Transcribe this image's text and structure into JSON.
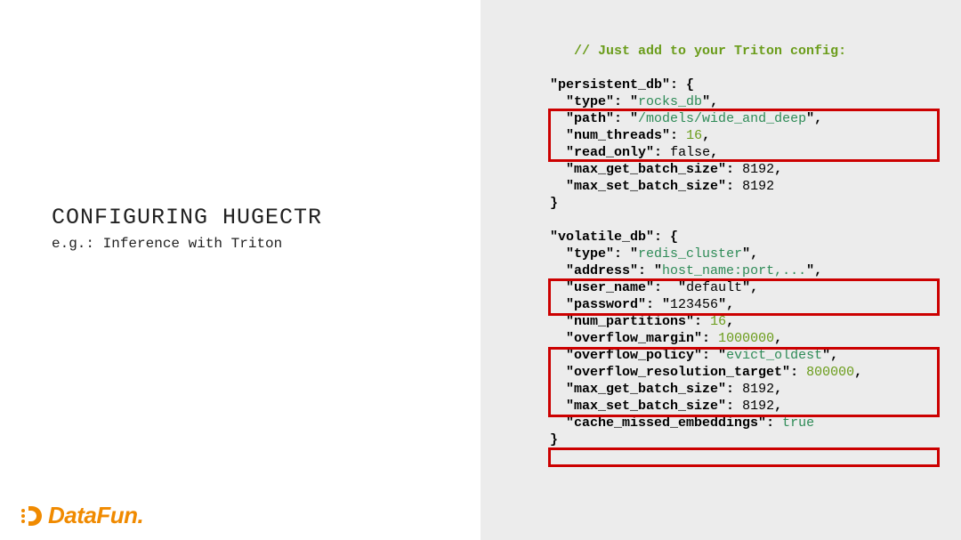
{
  "left": {
    "title": "CONFIGURING HUGECTR",
    "subtitle": "e.g.: Inference with Triton"
  },
  "logo": {
    "text": "DataFun."
  },
  "code": {
    "comment": "// Just add to your Triton config:",
    "persistent": {
      "open": "\"persistent_db\": {",
      "type_key": "\"type\"",
      "type_val": "rocks_db",
      "path_key": "\"path\"",
      "path_val": "/models/wide_and_deep",
      "num_threads_key": "\"num_threads\"",
      "num_threads_val": "16",
      "read_only_key": "\"read_only\"",
      "read_only_val": "false",
      "max_get_key": "\"max_get_batch_size\"",
      "max_get_val": "8192",
      "max_set_key": "\"max_set_batch_size\"",
      "max_set_val": "8192",
      "close": "}"
    },
    "volatile": {
      "open": "\"volatile_db\": {",
      "type_key": "\"type\"",
      "type_val": "redis_cluster",
      "address_key": "\"address\"",
      "address_val": "host_name:port,...",
      "user_name_key": "\"user_name\"",
      "user_name_val": "default",
      "password_key": "\"password\"",
      "password_val": "123456",
      "num_partitions_key": "\"num_partitions\"",
      "num_partitions_val": "16",
      "overflow_margin_key": "\"overflow_margin\"",
      "overflow_margin_val": "1000000",
      "overflow_policy_key": "\"overflow_policy\"",
      "overflow_policy_val": "evict_oldest",
      "overflow_target_key": "\"overflow_resolution_target\"",
      "overflow_target_val": "800000",
      "max_get_key": "\"max_get_batch_size\"",
      "max_get_val": "8192",
      "max_set_key": "\"max_set_batch_size\"",
      "max_set_val": "8192",
      "cache_key": "\"cache_missed_embeddings\"",
      "cache_val": "true",
      "close": "}"
    }
  }
}
